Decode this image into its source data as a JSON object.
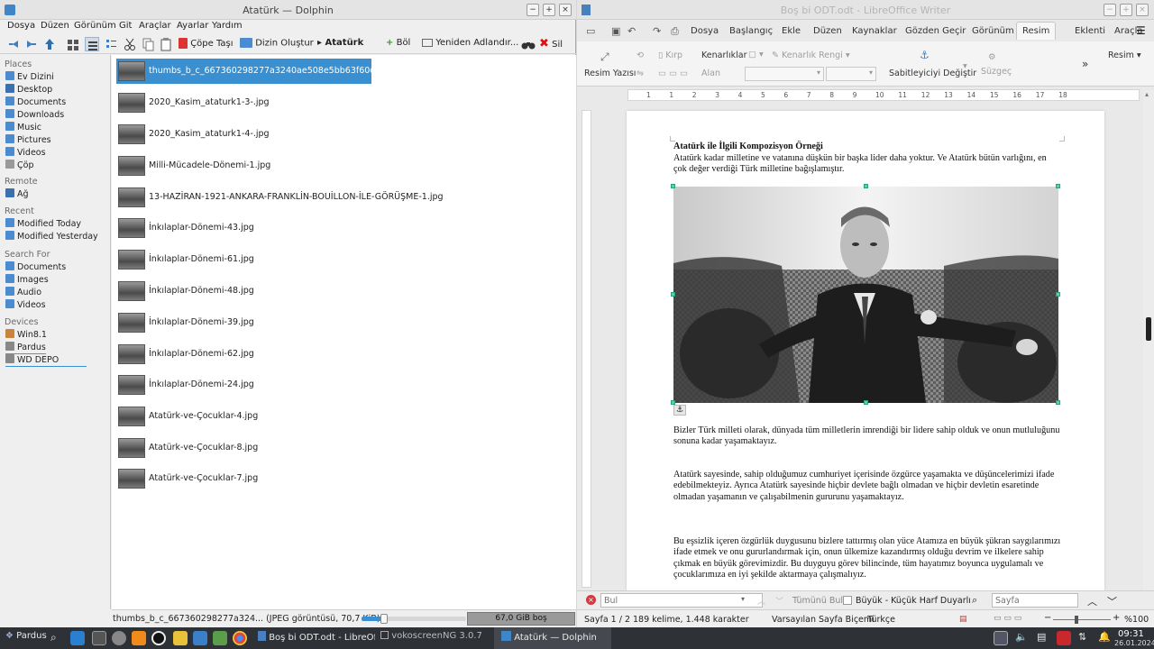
{
  "dolphin": {
    "title": "Atatürk — Dolphin",
    "menu": [
      "Dosya",
      "Düzen",
      "Görünüm",
      "Git",
      "Araçlar",
      "Ayarlar",
      "Yardım"
    ],
    "toolbar": {
      "trash": "Çöpe Taşı",
      "new_folder": "Dizin Oluştur",
      "location": "Atatürk",
      "split": "Böl",
      "rename": "Yeniden Adlandır...",
      "delete": "Sil"
    },
    "sidebar": {
      "places_header": "Places",
      "places": [
        "Ev Dizini",
        "Desktop",
        "Documents",
        "Downloads",
        "Music",
        "Pictures",
        "Videos",
        "Çöp"
      ],
      "remote_header": "Remote",
      "remote": [
        "Ağ"
      ],
      "recent_header": "Recent",
      "recent": [
        "Modified Today",
        "Modified Yesterday"
      ],
      "search_header": "Search For",
      "search": [
        "Documents",
        "Images",
        "Audio",
        "Videos"
      ],
      "devices_header": "Devices",
      "devices": [
        "Win8.1",
        "Pardus",
        "WD DEPO"
      ]
    },
    "files": [
      "thumbs_b_c_667360298277a3240ae508e5bb63f60d.jpg",
      "2020_Kasim_ataturk1-3-.jpg",
      "2020_Kasim_ataturk1-4-.jpg",
      "Milli-Mücadele-Dönemi-1.jpg",
      "13-HAZİRAN-1921-ANKARA-FRANKLİN-BOUİLLON-İLE-GÖRÜŞME-1.jpg",
      "İnkılaplar-Dönemi-43.jpg",
      "İnkılaplar-Dönemi-61.jpg",
      "İnkılaplar-Dönemi-48.jpg",
      "İnkılaplar-Dönemi-39.jpg",
      "İnkılaplar-Dönemi-62.jpg",
      "İnkılaplar-Dönemi-24.jpg",
      "Atatürk-ve-Çocuklar-4.jpg",
      "Atatürk-ve-Çocuklar-8.jpg",
      "Atatürk-ve-Çocuklar-7.jpg"
    ],
    "selected_index": 0,
    "status_text": "thumbs_b_c_667360298277a324... (JPEG görüntüsü, 70,7 KiB)",
    "free_space": "67,0 GiB boş"
  },
  "writer": {
    "title": "Boş bi ODT.odt - LibreOffice Writer",
    "tabs": [
      "Dosya",
      "Başlangıç",
      "Ekle",
      "Düzen",
      "Kaynaklar",
      "Gözden Geçir",
      "Görünüm",
      "Resim",
      "Eklenti",
      "Araçla"
    ],
    "active_tab": "Resim",
    "ribbon": {
      "crop": "Kırp",
      "borders": "Kenarlıklar",
      "border_color": "Kenarlık Rengi",
      "area": "Alan",
      "caption": "Resim Yazısı",
      "anchor": "Sabitleyiciyi Değiştir",
      "filter": "Süzgeç",
      "image_menu": "Resim"
    },
    "ruler_numbers": [
      "1",
      "1",
      "2",
      "3",
      "4",
      "5",
      "6",
      "7",
      "8",
      "9",
      "10",
      "11",
      "12",
      "13",
      "14",
      "15",
      "16",
      "17",
      "18"
    ],
    "document": {
      "heading": "Atatürk ile İlgili Kompozisyon Örneği",
      "intro": "Atatürk kadar milletine ve vatanına düşkün bir başka lider daha yoktur. Ve Atatürk bütün varlığını, en çok değer verdiği Türk milletine bağışlamıştır.",
      "p1": "Bizler Türk milleti olarak, dünyada tüm milletlerin imrendiği bir lidere sahip olduk ve onun mutluluğunu sonuna kadar yaşamaktayız.",
      "p2": "Atatürk sayesinde, sahip olduğumuz cumhuriyet içerisinde özgürce yaşamakta ve düşüncelerimizi ifade edebilmekteyiz. Ayrıca Atatürk sayesinde hiçbir devlete bağlı olmadan ve hiçbir devletin esaretinde olmadan yaşamanın ve çalışabilmenin gururunu yaşamaktayız.",
      "p3": "Bu eşsizlik içeren özgürlük duygusunu bizlere tattırmış olan yüce Atamıza en büyük şükran saygılarımızı ifade etmek ve onu gururlandırmak için, onun ülkemize kazandırmış olduğu devrim ve ilkelere sahip çıkmak en büyük görevimizdir. Bu duyguyu görev bilincinde, tüm hayatımız boyunca uygulamalı ve çocuklarımıza en iyi şekilde aktarmaya çalışmalıyız."
    },
    "find": {
      "placeholder": "Bul",
      "find_all": "Tümünü Bul",
      "match_case": "Büyük - Küçük Harf Duyarlı",
      "page_placeholder": "Sayfa"
    },
    "status": {
      "page": "Sayfa 1 / 2",
      "words": "189 kelime, 1.448 karakter",
      "style": "Varsayılan Sayfa Biçemi",
      "language": "Türkçe",
      "zoom": "%100"
    }
  },
  "taskbar": {
    "start": "Pardus",
    "tasks": [
      "Boş bi ODT.odt - LibreOf...",
      "vokoscreenNG 3.0.7",
      "Atatürk — Dolphin"
    ],
    "time": "09:31",
    "date": "26.01.2024"
  }
}
